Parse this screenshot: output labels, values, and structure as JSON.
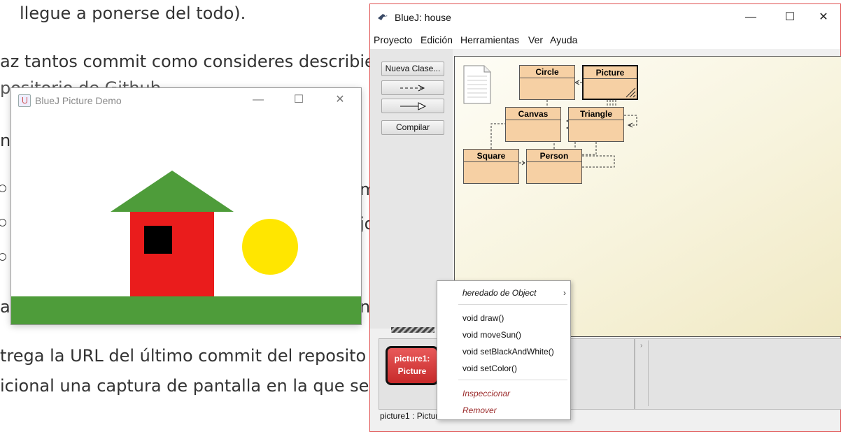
{
  "document": {
    "line1": "llegue a ponerse del todo).",
    "line2": "az tantos commit como consideres describie",
    "line3": "positorio de Github.",
    "line4": "n",
    "line5": "az",
    "line6": "trega la URL del último commit del reposito",
    "line7": "icional una captura de pantalla en la que se",
    "frag_m": "m",
    "frag_jo": "jo",
    "frag_n": "n"
  },
  "picture_demo": {
    "title": "BlueJ Picture Demo",
    "controls": {
      "minimize": "—",
      "maximize": "☐",
      "close": "✕"
    },
    "colors": {
      "roof": "#4e9c3a",
      "wall": "#ea1c1c",
      "window": "#000000",
      "sun": "#ffe600",
      "ground": "#4e9c3a"
    }
  },
  "bluej": {
    "title": "BlueJ:  house",
    "controls": {
      "minimize": "—",
      "maximize": "☐",
      "close": "✕"
    },
    "menu": [
      "Proyecto",
      "Edición",
      "Herramientas",
      "Ver",
      "Ayuda"
    ],
    "toolbar": {
      "new_class": "Nueva Clase...",
      "dependency_arrow": "--->",
      "inheritance_arrow": "——▷",
      "compile": "Compilar"
    },
    "classes": {
      "circle": "Circle",
      "picture": "Picture",
      "canvas": "Canvas",
      "triangle": "Triangle",
      "square": "Square",
      "person": "Person"
    },
    "object_bench": {
      "object_name": "picture1:",
      "object_class": "Picture"
    },
    "status": "picture1 : Pictur"
  },
  "context_menu": {
    "inherited": "heredado de Object",
    "methods": [
      "void draw()",
      "void moveSun()",
      "void setBlackAndWhite()",
      "void setColor()"
    ],
    "inspect": "Inspeccionar",
    "remove": "Remover"
  }
}
